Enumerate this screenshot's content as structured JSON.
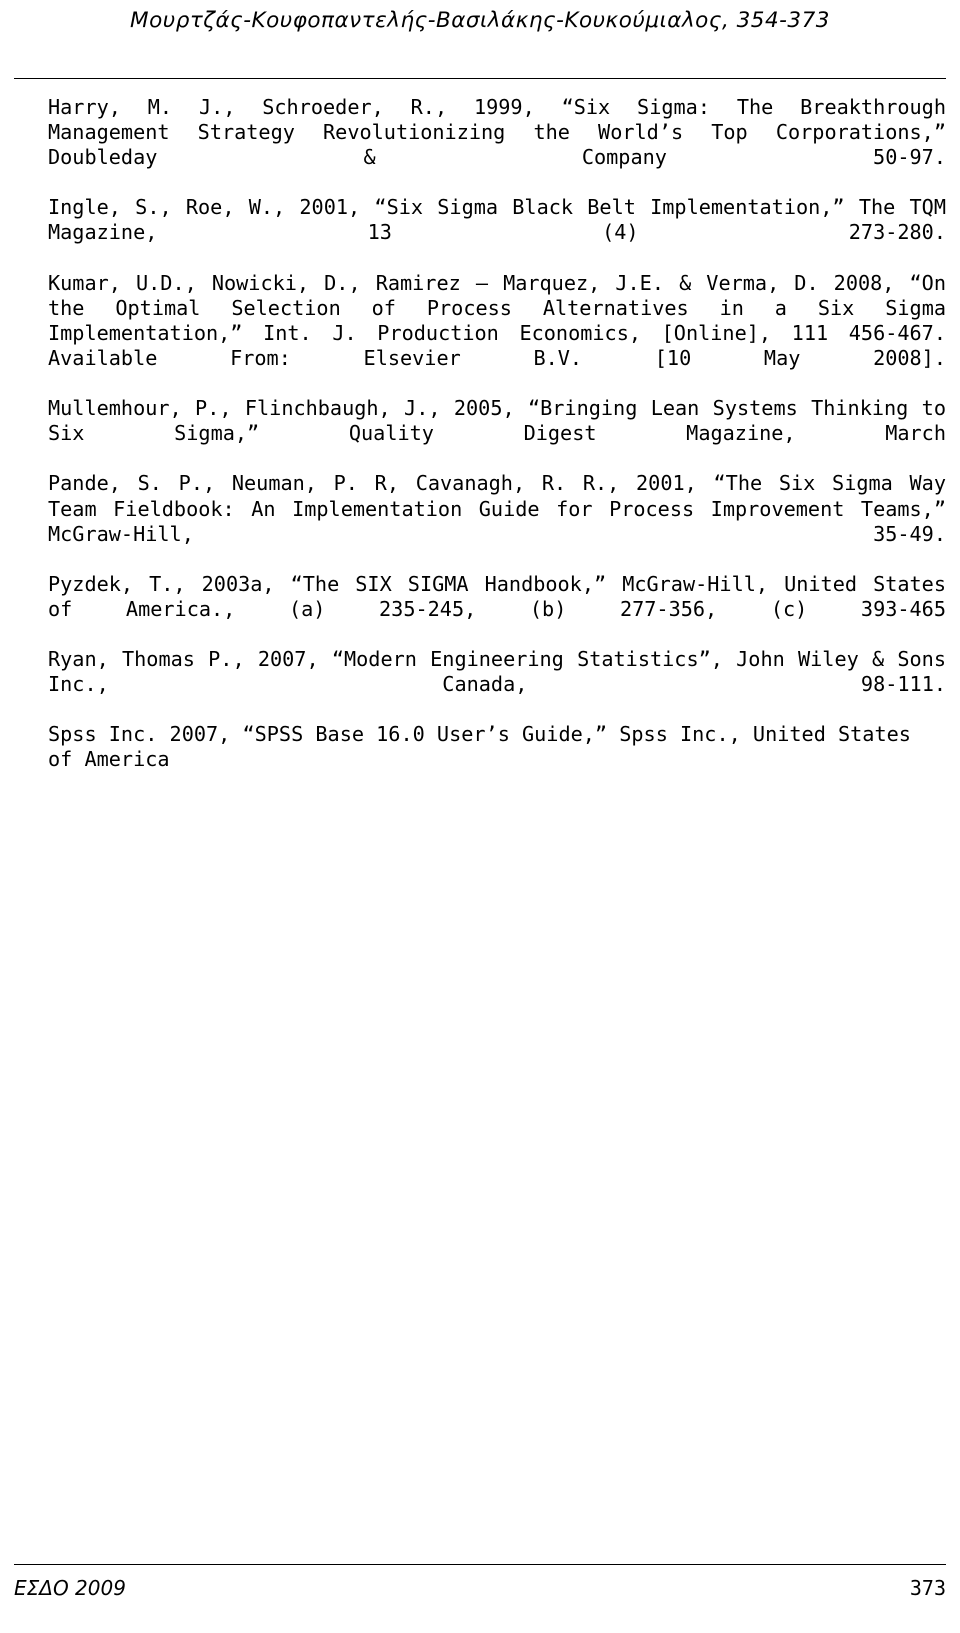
{
  "header": {
    "running_title": "Μουρτζάς-Κουφοπαντελής-Βασιλάκης-Κουκούμιαλος, 354-373"
  },
  "references": [
    {
      "id": "harry-schroeder-1999",
      "text": "Harry, M. J., Schroeder, R., 1999, “Six Sigma: The Breakthrough Management Strategy Revolutionizing the World’s Top Corporations,” Doubleday & Company 50-97."
    },
    {
      "id": "ingle-roe-2001",
      "text": "Ingle, S., Roe, W., 2001, “Six Sigma Black Belt Implementation,” The TQM Magazine, 13 (4) 273-280."
    },
    {
      "id": "kumar-nowicki-2008",
      "text": "Kumar, U.D., Nowicki, D., Ramirez – Marquez, J.E. & Verma, D. 2008, “On the Optimal Selection of Process Alternatives in a Six Sigma Implementation,” Int. J. Production Economics, [Online], 111 456-467. Available From: Elsevier B.V. [10 May 2008]."
    },
    {
      "id": "mullemhour-flinchbaugh-2005",
      "text": "Mullemhour, P., Flinchbaugh, J., 2005, “Bringing Lean Systems Thinking to Six Sigma,” Quality Digest Magazine, March"
    },
    {
      "id": "pande-neuman-cavanagh-2001",
      "text": "Pande, S. P., Neuman, P. R, Cavanagh, R. R., 2001, “The Six Sigma Way Team Fieldbook: An Implementation Guide for Process Improvement Teams,” McGraw-Hill, 35-49."
    },
    {
      "id": "pyzdek-2003a",
      "text": "Pyzdek, T., 2003a, “The SIX SIGMA Handbook,” McGraw-Hill, United States of America., (a) 235-245, (b) 277-356, (c) 393-465"
    },
    {
      "id": "ryan-2007",
      "text": "Ryan, Thomas P., 2007, “Modern Engineering Statistics”, John Wiley & Sons Inc., Canada, 98-111."
    },
    {
      "id": "spss-2007",
      "text": "Spss Inc. 2007, “SPSS Base 16.0 User’s Guide,” Spss Inc., United States of America"
    }
  ],
  "footer": {
    "journal": "ΕΣΔΟ 2009",
    "page_number": "373"
  }
}
